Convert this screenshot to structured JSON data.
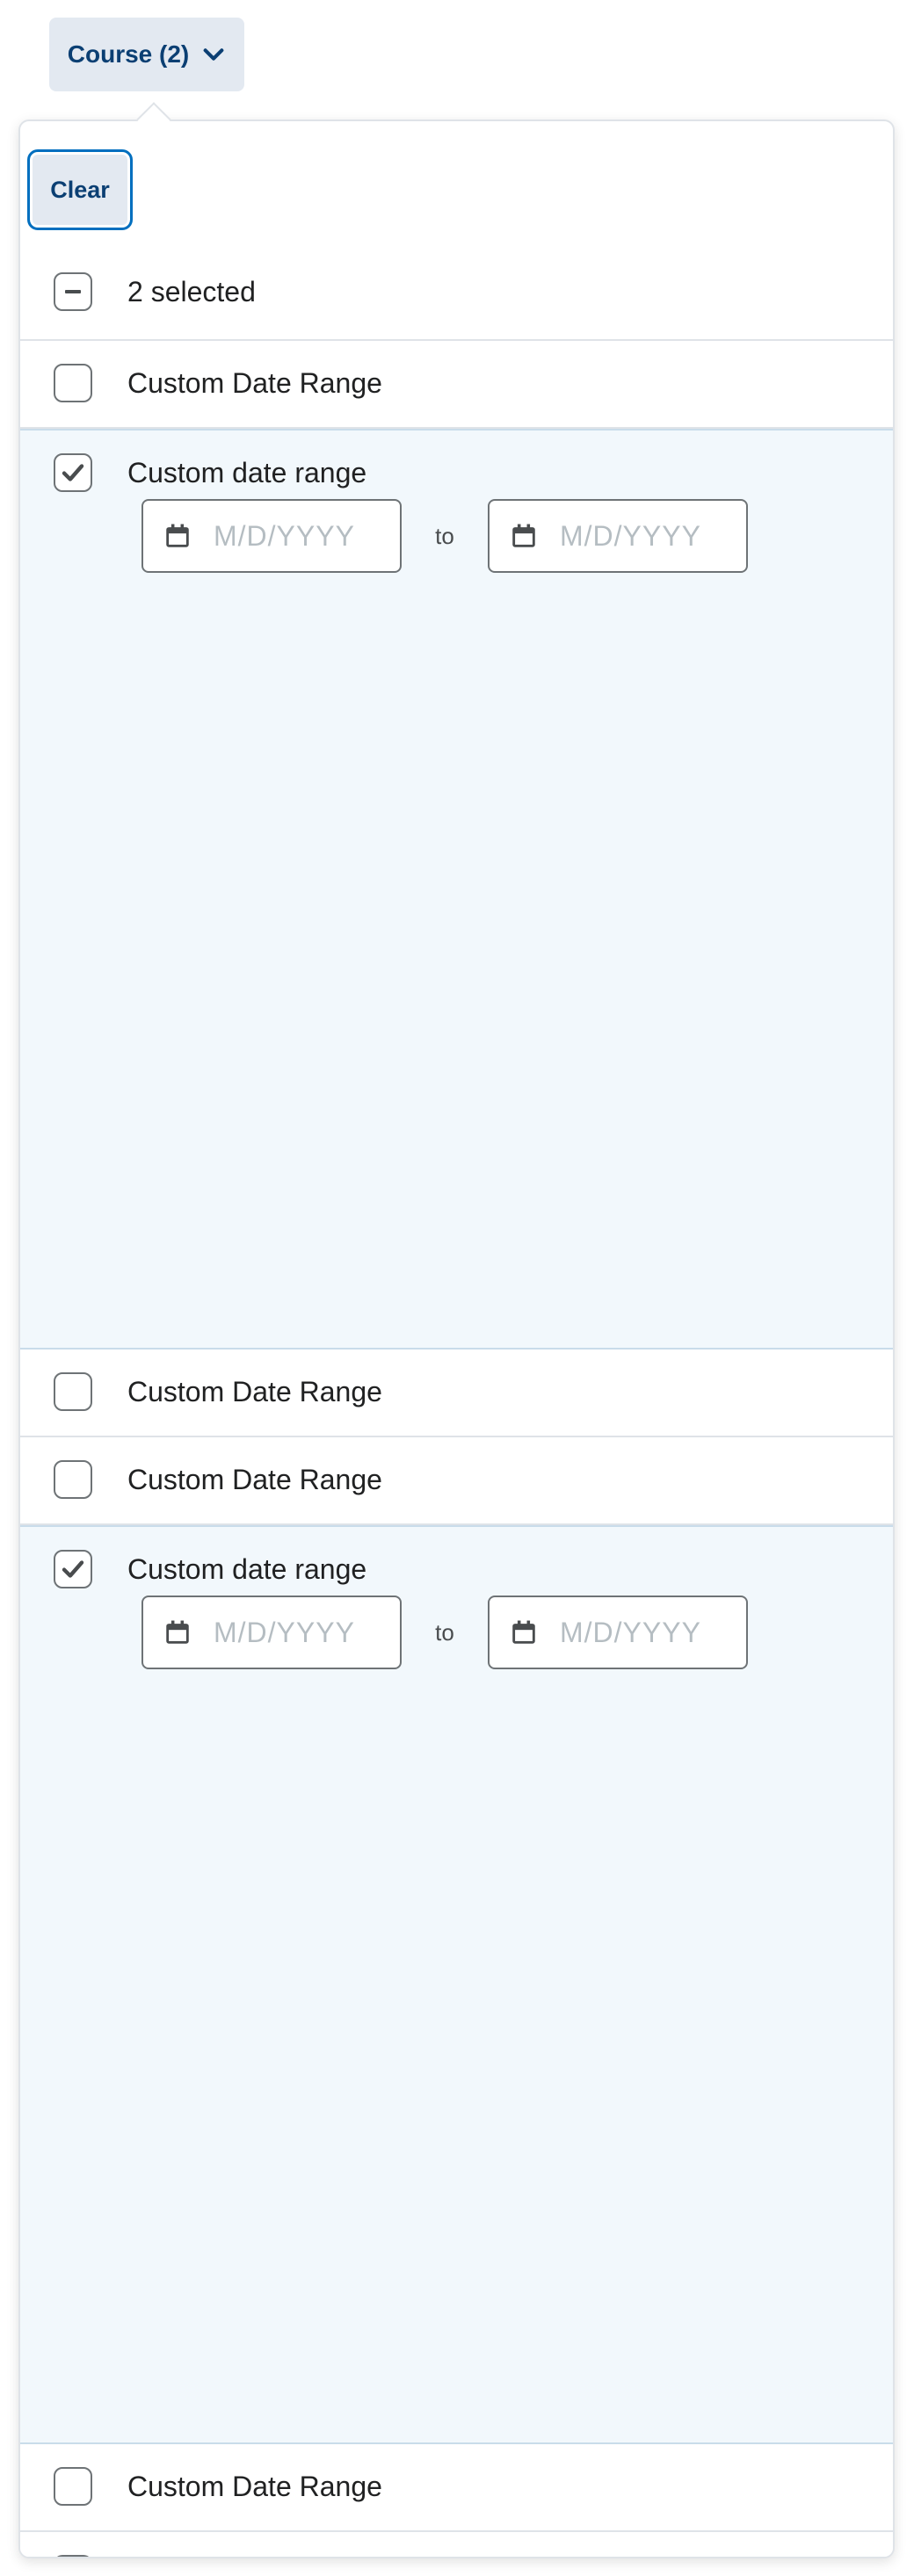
{
  "opener": {
    "label": "Course (2)"
  },
  "dropdown": {
    "clear_label": "Clear",
    "select_all_label": "2 selected",
    "items": [
      {
        "label": "Custom Date Range",
        "checked": false
      },
      {
        "label": "Custom date range",
        "checked": true,
        "range": {
          "start_placeholder": "M/D/YYYY",
          "separator": "to",
          "end_placeholder": "M/D/YYYY"
        }
      },
      {
        "label": "Custom Date Range",
        "checked": false
      },
      {
        "label": "Custom Date Range",
        "checked": false
      },
      {
        "label": "Custom date range",
        "checked": true,
        "range": {
          "start_placeholder": "M/D/YYYY",
          "separator": "to",
          "end_placeholder": "M/D/YYYY"
        }
      },
      {
        "label": "Custom Date Range",
        "checked": false
      }
    ]
  },
  "colors": {
    "accent": "#006fbf",
    "button_bg": "#e3e9f1",
    "selected_row_bg": "#f2f8fc",
    "border": "#dfe3e8",
    "placeholder": "#b5bdc2"
  },
  "icons": {
    "opener": "chevron-down-icon",
    "select_all": "minus-icon",
    "checked": "check-icon",
    "date": "calendar-icon"
  }
}
